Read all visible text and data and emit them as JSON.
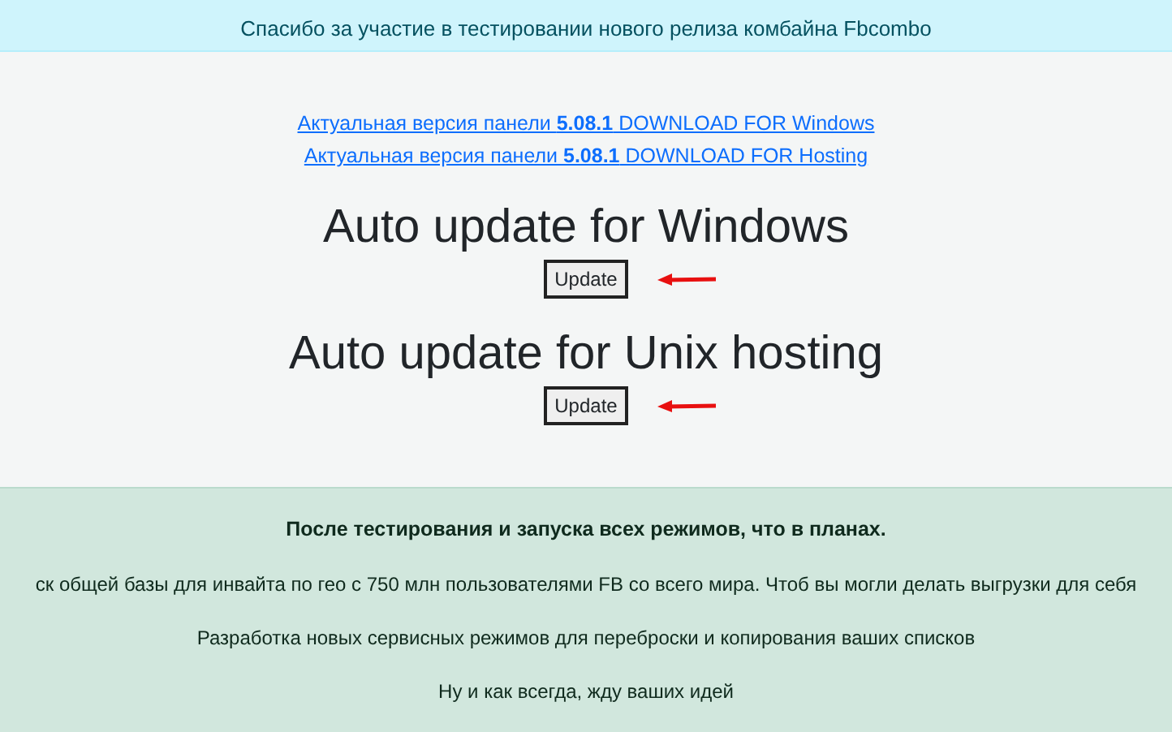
{
  "banner": {
    "text": "Спасибо за участие в тестировании нового релиза комбайна Fbcombo"
  },
  "download_links": [
    "Актуальная версия панели **5.08.1** DOWNLOAD FOR Windows",
    "Актуальная версия панели **5.08.1** DOWNLOAD FOR Hosting"
  ],
  "updates": [
    {
      "title": "Auto update for Windows",
      "button": "Update"
    },
    {
      "title": "Auto update for Unix hosting",
      "button": "Update"
    }
  ],
  "plans": {
    "heading": "После тестирования и запуска всех режимов, что в планах.",
    "items": [
      "ск общей базы для инвайта по гео с 750 млн пользователями FB со всего мира. Чтоб вы могли делать выгрузки для себя",
      "Разработка новых сервисных режимов для переброски и копирования ваших списков",
      "Ну и как всегда, жду ваших идей"
    ]
  }
}
